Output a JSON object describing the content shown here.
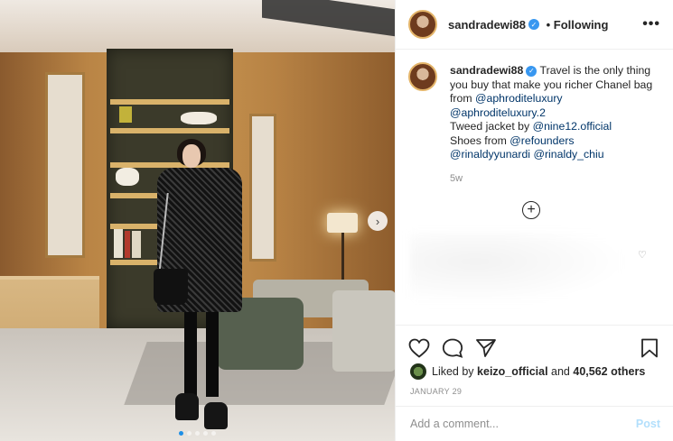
{
  "post": {
    "username": "sandradewi88",
    "follow_status": "Following",
    "more_label": "•••",
    "caption_text_1": "Travel is the only thing you buy that make you richer Chanel bag from ",
    "mention_1": "@aphroditeluxury",
    "mention_2": "@aphroditeluxury.2",
    "caption_text_2": "Tweed jacket by ",
    "mention_3": "@nine12.official",
    "caption_text_3": "Shoes from ",
    "mention_4": "@refounders",
    "mention_5": "@rinaldyyunardi",
    "mention_6": "@rinaldy_chiu",
    "age": "5w",
    "liked_by_prefix": "Liked by ",
    "liked_by_user": "keizo_official",
    "liked_by_and": " and ",
    "likes_count": "40,562 others",
    "date": "JANUARY 29"
  },
  "comment": {
    "placeholder": "Add a comment...",
    "post_label": "Post"
  },
  "carousel": {
    "total_slides": 5,
    "active_slide": 1
  },
  "icons": {
    "verified": "verified-badge",
    "more": "more-options-icon",
    "next": "chevron-right-icon",
    "like": "heart-icon",
    "comment": "comment-bubble-icon",
    "share": "paper-plane-icon",
    "save": "bookmark-icon",
    "load_more": "plus-circle-icon"
  },
  "colors": {
    "verified": "#3897f0",
    "mention": "#003569",
    "muted": "#8e8e8e",
    "post_disabled": "#b2dffc",
    "active_dot": "#1e8fe6"
  }
}
